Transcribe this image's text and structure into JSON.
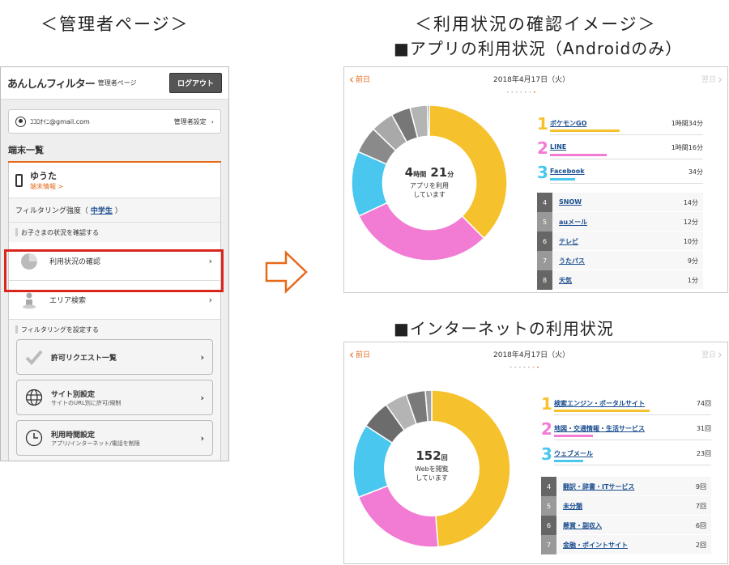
{
  "headings": {
    "admin": "＜管理者ページ＞",
    "image": "＜利用状況の確認イメージ＞",
    "app": "■アプリの利用状況（Androidのみ）",
    "web": "■インターネットの利用状況"
  },
  "phone": {
    "logo": "あんしんフィルター",
    "admin_label": "管理者ページ",
    "logout": "ログアウト",
    "account": "ｺｺﾛｵｲﾆ@gmail.com",
    "account_settings": "管理者設定",
    "device_section": "端末一覧",
    "device_name": "ゆうた",
    "device_link": "端末情報 >",
    "filter_label": "フィルタリング強度（",
    "filter_level": "中学生",
    "filter_close": "）",
    "status_header": "お子さまの状況を確認する",
    "usage_check": "利用状況の確認",
    "area_search": "エリア検索",
    "filter_header": "フィルタリングを設定する",
    "permit_list": "許可リクエスト一覧",
    "site_settings": "サイト別設定",
    "site_sub": "サイトのURL別に許可/規制",
    "time_settings": "利用時間設定",
    "time_sub": "アプリ/インターネット/電話を制限"
  },
  "app_panel": {
    "prev": "前日",
    "date": "2018年4月17日（火）",
    "next": "翌日",
    "total_num1": "4",
    "total_unit1": "時間",
    "total_num2": "21",
    "total_unit2": "分",
    "center_line1": "アプリを利用",
    "center_line2": "しています",
    "top": [
      {
        "rank": "1",
        "name": "ポケモンGO",
        "value": "1時間34分",
        "color": "#f5c22e",
        "share": 0.36
      },
      {
        "rank": "2",
        "name": "LINE",
        "value": "1時間16分",
        "color": "#f27bd3",
        "share": 0.29
      },
      {
        "rank": "3",
        "name": "Facebook",
        "value": "34分",
        "color": "#49c7ef",
        "share": 0.13
      }
    ],
    "rest": [
      {
        "rank": "4",
        "name": "SNOW",
        "value": "14分",
        "color": "#666666"
      },
      {
        "rank": "5",
        "name": "auメール",
        "value": "12分",
        "color": "#999999"
      },
      {
        "rank": "6",
        "name": "テレビ",
        "value": "10分",
        "color": "#666666"
      },
      {
        "rank": "7",
        "name": "うたパス",
        "value": "9分",
        "color": "#999999"
      },
      {
        "rank": "8",
        "name": "天気",
        "value": "1分",
        "color": "#666666"
      }
    ]
  },
  "web_panel": {
    "prev": "前日",
    "date": "2018年4月17日（火）",
    "next": "翌日",
    "total_num": "152",
    "total_unit": "回",
    "center_line1": "Webを閲覧",
    "center_line2": "しています",
    "top": [
      {
        "rank": "1",
        "name": "検索エンジン・ポータルサイト",
        "value": "74回",
        "color": "#f5c22e",
        "share": 0.49
      },
      {
        "rank": "2",
        "name": "地図・交通情報・生活サービス",
        "value": "31回",
        "color": "#f27bd3",
        "share": 0.2
      },
      {
        "rank": "3",
        "name": "ウェブメール",
        "value": "23回",
        "color": "#49c7ef",
        "share": 0.15
      }
    ],
    "rest": [
      {
        "rank": "4",
        "name": "翻訳・辞書・ITサービス",
        "value": "9回",
        "color": "#666666"
      },
      {
        "rank": "5",
        "name": "未分類",
        "value": "7回",
        "color": "#999999"
      },
      {
        "rank": "6",
        "name": "懸賞・副収入",
        "value": "6回",
        "color": "#666666"
      },
      {
        "rank": "7",
        "name": "金融・ポイントサイト",
        "value": "2回",
        "color": "#999999"
      }
    ]
  },
  "chart_data": [
    {
      "type": "pie",
      "categories": [
        "ポケモンGO",
        "LINE",
        "Facebook",
        "SNOW",
        "auメール",
        "テレビ",
        "うたパス",
        "天気"
      ],
      "values": [
        94,
        76,
        34,
        14,
        12,
        10,
        9,
        1
      ]
    },
    {
      "type": "pie",
      "categories": [
        "検索エンジン・ポータルサイト",
        "地図・交通情報・生活サービス",
        "ウェブメール",
        "翻訳・辞書・ITサービス",
        "未分類",
        "懸賞・副収入",
        "金融・ポイントサイト"
      ],
      "values": [
        74,
        31,
        23,
        9,
        7,
        6,
        2
      ]
    }
  ]
}
